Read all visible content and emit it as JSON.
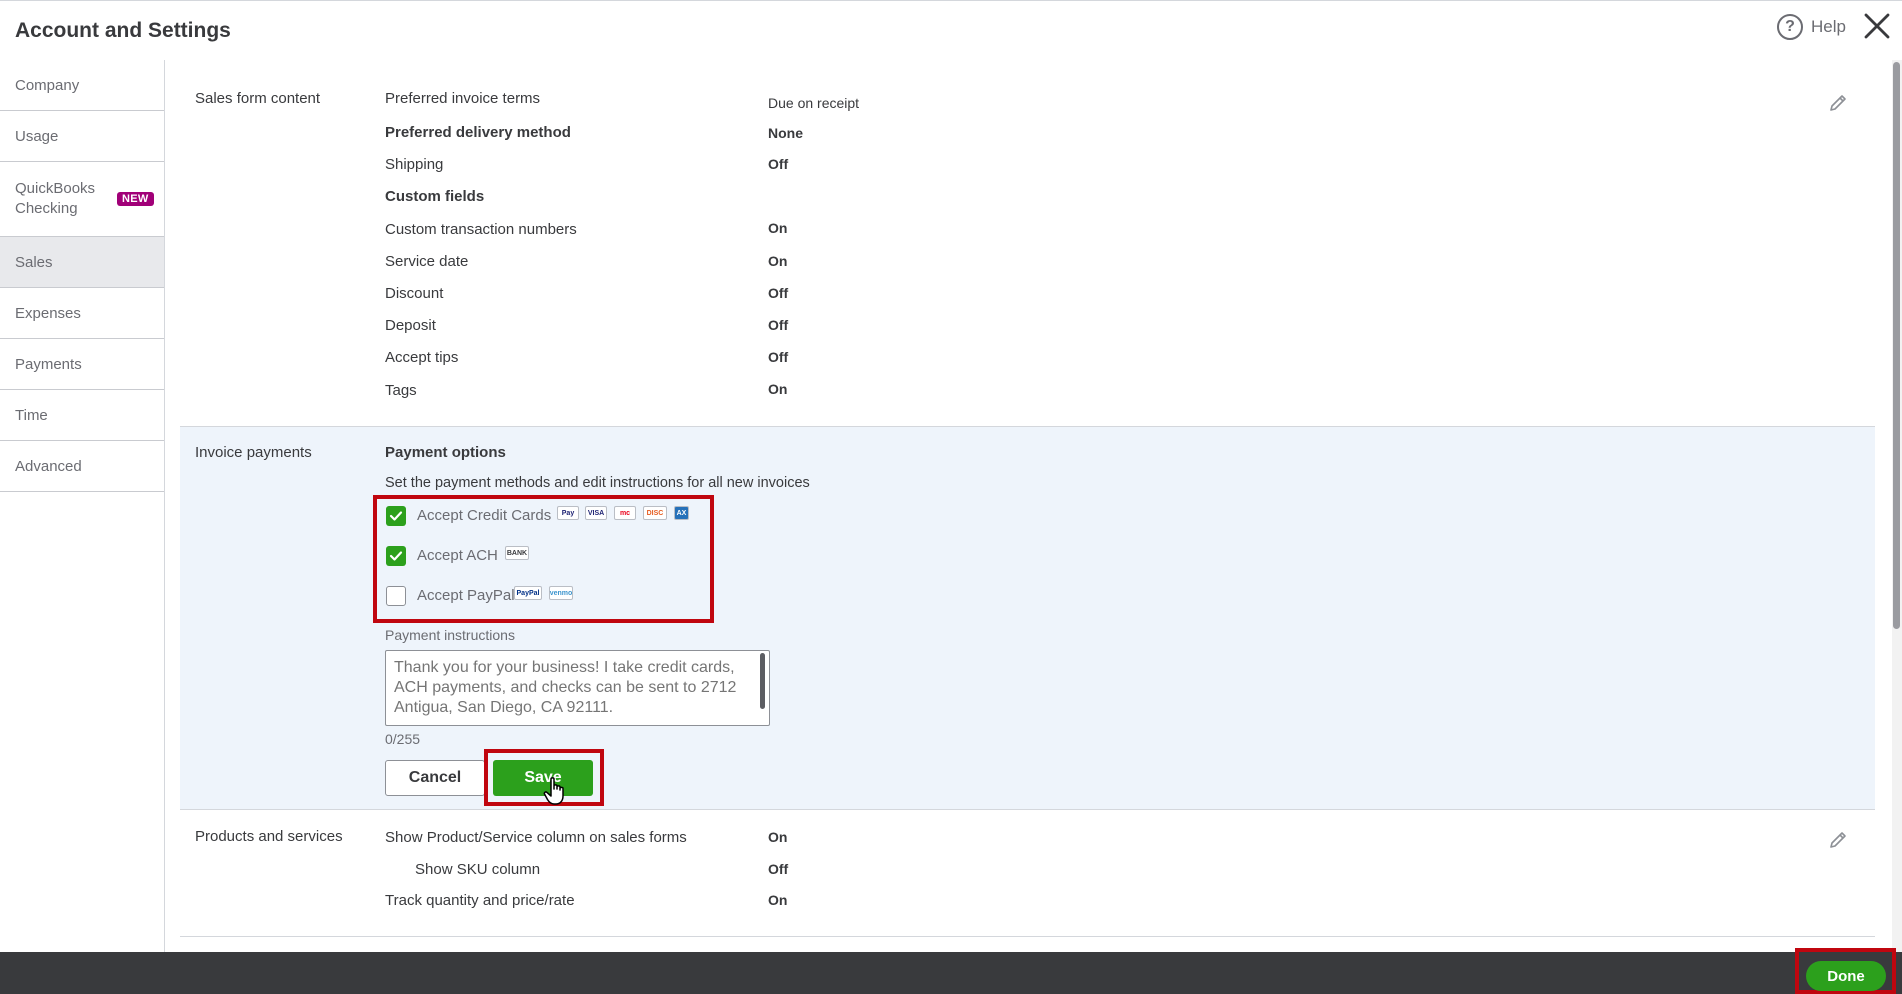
{
  "header": {
    "title": "Account and Settings",
    "help_label": "Help"
  },
  "sidebar": {
    "items": [
      {
        "label": "Company"
      },
      {
        "label": "Usage"
      },
      {
        "label": "QuickBooks Checking",
        "badge": "NEW"
      },
      {
        "label": "Sales"
      },
      {
        "label": "Expenses"
      },
      {
        "label": "Payments"
      },
      {
        "label": "Time"
      },
      {
        "label": "Advanced"
      }
    ]
  },
  "sales_form_content": {
    "section_label": "Sales form content",
    "rows": [
      {
        "label": "Preferred invoice terms",
        "value": "Due on receipt"
      },
      {
        "label": "Preferred delivery method",
        "value": "None"
      },
      {
        "label": "Shipping",
        "value": "Off"
      },
      {
        "label": "Custom fields",
        "value": ""
      },
      {
        "label": "Custom transaction numbers",
        "value": "On"
      },
      {
        "label": "Service date",
        "value": "On"
      },
      {
        "label": "Discount",
        "value": "Off"
      },
      {
        "label": "Deposit",
        "value": "Off"
      },
      {
        "label": "Accept tips",
        "value": "Off"
      },
      {
        "label": "Tags",
        "value": "On"
      }
    ]
  },
  "invoice_payments": {
    "section_label": "Invoice payments",
    "options_title": "Payment options",
    "options_description": "Set the payment methods and edit instructions for all new invoices",
    "methods": [
      {
        "label": "Accept Credit Cards",
        "checked": true,
        "logos": [
          "Pay",
          "VISA",
          "mc",
          "DISC",
          "AX"
        ]
      },
      {
        "label": "Accept ACH",
        "checked": true,
        "logos": [
          "BANK"
        ]
      },
      {
        "label": "Accept PayPal",
        "checked": false,
        "logos": [
          "PayPal",
          "venmo"
        ]
      }
    ],
    "instructions_label": "Payment instructions",
    "instructions_placeholder": "Thank you for your business! I take credit cards, ACH payments, and checks can be sent to 2712 Antigua, San Diego, CA 92111.",
    "char_count": "0/255",
    "cancel_label": "Cancel",
    "save_label": "Save"
  },
  "products_services": {
    "section_label": "Products and services",
    "rows": [
      {
        "label": "Show Product/Service column on sales forms",
        "value": "On"
      },
      {
        "label": "Show SKU column",
        "value": "Off"
      },
      {
        "label": "Track quantity and price/rate",
        "value": "On"
      }
    ]
  },
  "footer": {
    "done_label": "Done"
  },
  "colors": {
    "accent_green": "#2ca01c",
    "highlight_red": "#c0060f",
    "badge_purple": "#a10078",
    "footer_dark": "#393a3d",
    "panel_blue": "#eef4fb"
  }
}
